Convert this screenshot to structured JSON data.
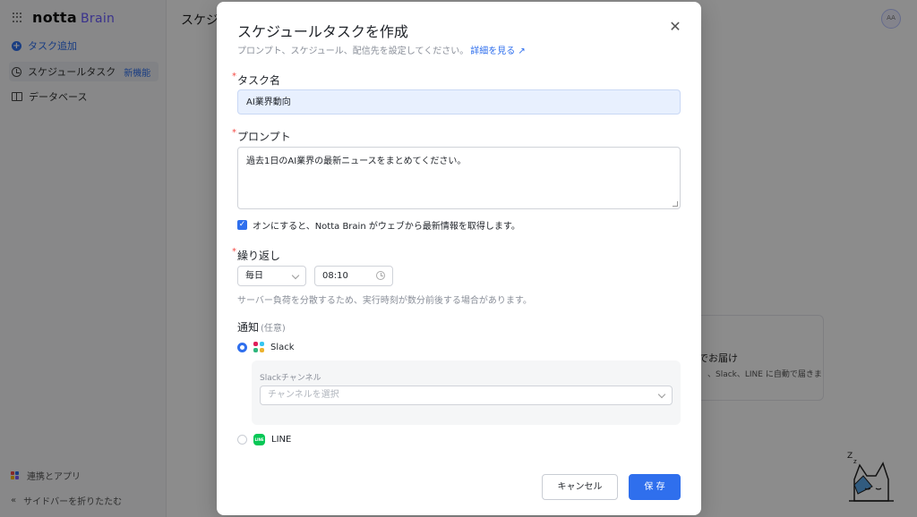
{
  "app": {
    "logo": "notta",
    "logo_suffix": "Brain",
    "page_title": "スケジュ",
    "avatar_text": "AA"
  },
  "sidebar": {
    "add_task": "タスク追加",
    "items": [
      {
        "label": "スケジュールタスク",
        "badge": "新機能",
        "active": true
      },
      {
        "label": "データベース",
        "active": false
      }
    ],
    "footer": {
      "integrations": "連携とアプリ",
      "collapse": "サイドバーを折りたたむ"
    }
  },
  "background_card": {
    "title": "でお届け",
    "text": "、Slack、LINE に自動で届きま"
  },
  "modal": {
    "title": "スケジュールタスクを作成",
    "subtitle": "プロンプト、スケジュール、配信先を設定してください。",
    "details_link": "詳細を見る ↗",
    "task_name": {
      "label": "タスク名",
      "value": "AI業界動向"
    },
    "prompt": {
      "label": "プロンプト",
      "value": "過去1日のAI業界の最新ニュースをまとめてください。"
    },
    "web_search": {
      "checked": true,
      "label": "オンにすると、Notta Brain がウェブから最新情報を取得します。"
    },
    "repeat": {
      "label": "繰り返し",
      "frequency": "毎日",
      "time": "08:10",
      "hint": "サーバー負荷を分散するため、実行時刻が数分前後する場合があります。"
    },
    "notify": {
      "label": "通知",
      "optional": "(任意)",
      "options": [
        {
          "label": "Slack",
          "selected": true
        },
        {
          "label": "LINE",
          "selected": false
        }
      ],
      "slack_channel_label": "Slackチャンネル",
      "slack_channel_placeholder": "チャンネルを選択"
    },
    "buttons": {
      "cancel": "キャンセル",
      "save": "保 存"
    }
  },
  "colors": {
    "accent": "#2f6fed",
    "required": "#f54a45",
    "line_green": "#06c755"
  }
}
